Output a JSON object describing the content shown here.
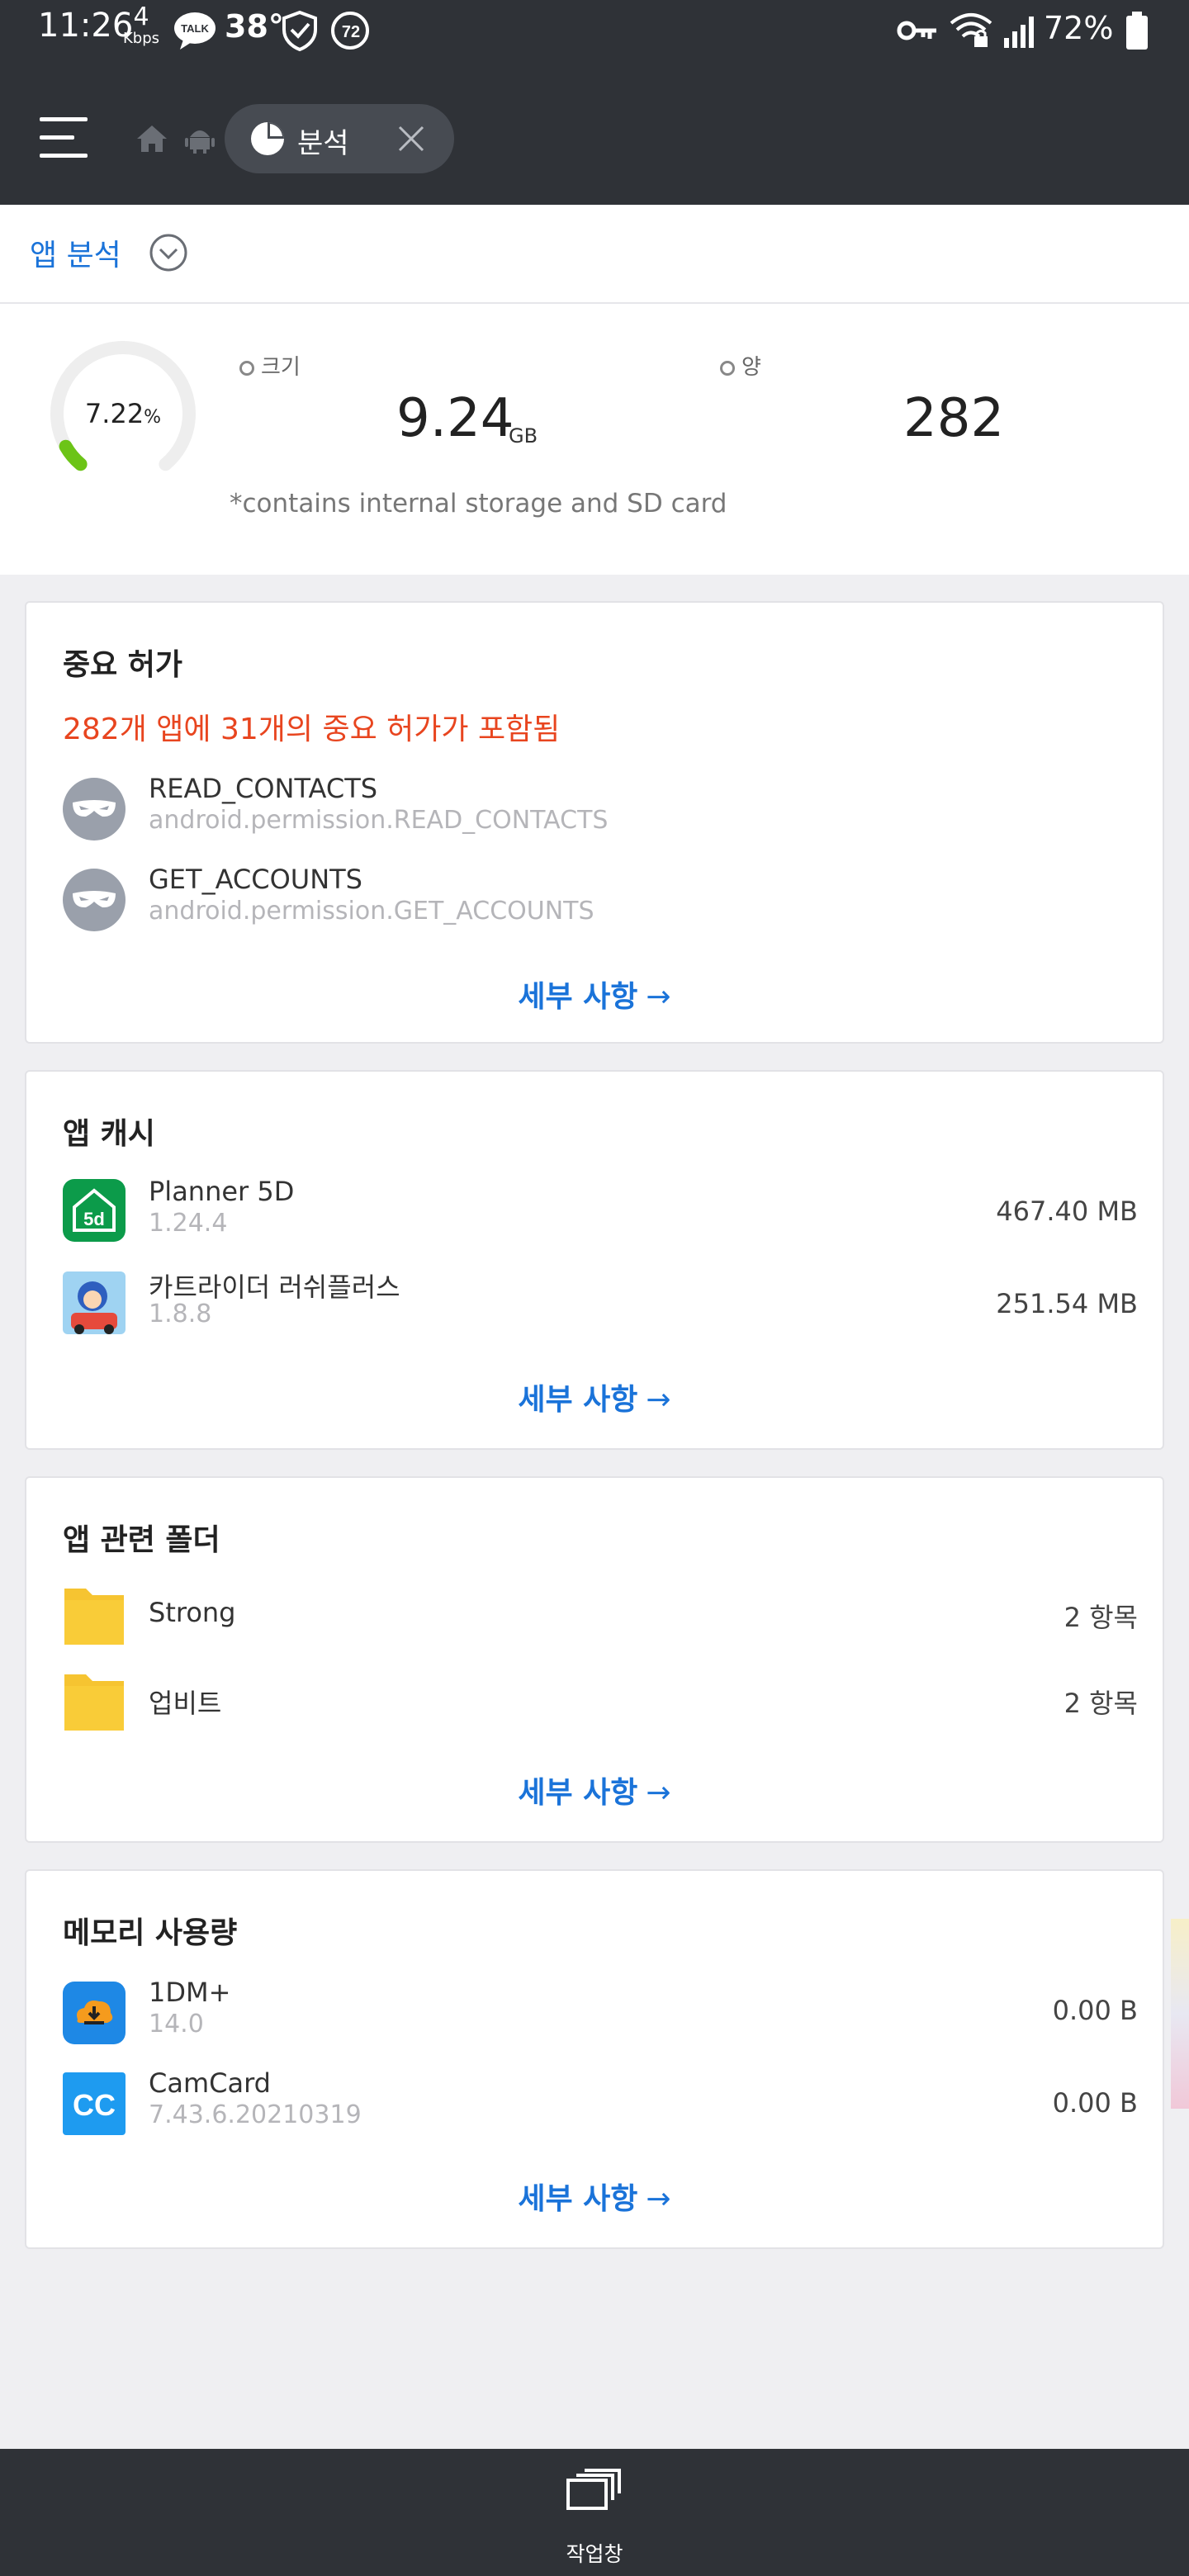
{
  "status_bar": {
    "time": "11:26",
    "net_speed_value": "4",
    "net_speed_unit": "Kbps",
    "talk_badge": "TALK",
    "temperature": "38°",
    "circle_badge": "72",
    "battery_percent": "72%"
  },
  "nav": {
    "tab_label": "분석"
  },
  "header": {
    "title": "앱 분석"
  },
  "summary": {
    "percent_value": "7.22",
    "percent_sign": "%",
    "percent_fill": 0.0722,
    "size_label": "크기",
    "size_value": "9.24",
    "size_unit": "GB",
    "count_label": "양",
    "count_value": "282",
    "note": "*contains internal storage and SD card"
  },
  "permissions_card": {
    "title": "중요 허가",
    "warning": "282개 앱에 31개의 중요 허가가 포함됨",
    "items": [
      {
        "name": "READ_CONTACTS",
        "detail": "android.permission.READ_CONTACTS"
      },
      {
        "name": "GET_ACCOUNTS",
        "detail": "android.permission.GET_ACCOUNTS"
      }
    ],
    "details_label": "세부 사항"
  },
  "cache_card": {
    "title": "앱 캐시",
    "items": [
      {
        "name": "Planner 5D",
        "version": "1.24.4",
        "size": "467.40 MB"
      },
      {
        "name": "카트라이더 러쉬플러스",
        "version": "1.8.8",
        "size": "251.54 MB"
      }
    ],
    "details_label": "세부 사항"
  },
  "folders_card": {
    "title": "앱 관련 폴더",
    "items": [
      {
        "name": "Strong",
        "count": "2 항목"
      },
      {
        "name": "업비트",
        "count": "2 항목"
      }
    ],
    "details_label": "세부 사항"
  },
  "memory_card": {
    "title": "메모리 사용량",
    "items": [
      {
        "name": "1DM+",
        "version": "14.0",
        "size": "0.00 B"
      },
      {
        "name": "CamCard",
        "version": "7.43.6.20210319",
        "size": "0.00 B"
      }
    ],
    "details_label": "세부 사항"
  },
  "bottom_bar": {
    "task_label": "작업창"
  },
  "colors": {
    "accent_blue": "#1a73d9",
    "warning_red": "#e8451f",
    "dark_bar": "#2f3237",
    "gauge_green": "#6cc417",
    "folder_yellow": "#f6c431"
  },
  "icons": [
    "hamburger-icon",
    "home-icon",
    "android-icon",
    "pie-chart-icon",
    "close-icon",
    "chevron-down-icon",
    "mask-icon",
    "folder-icon",
    "taskbar-icon"
  ]
}
